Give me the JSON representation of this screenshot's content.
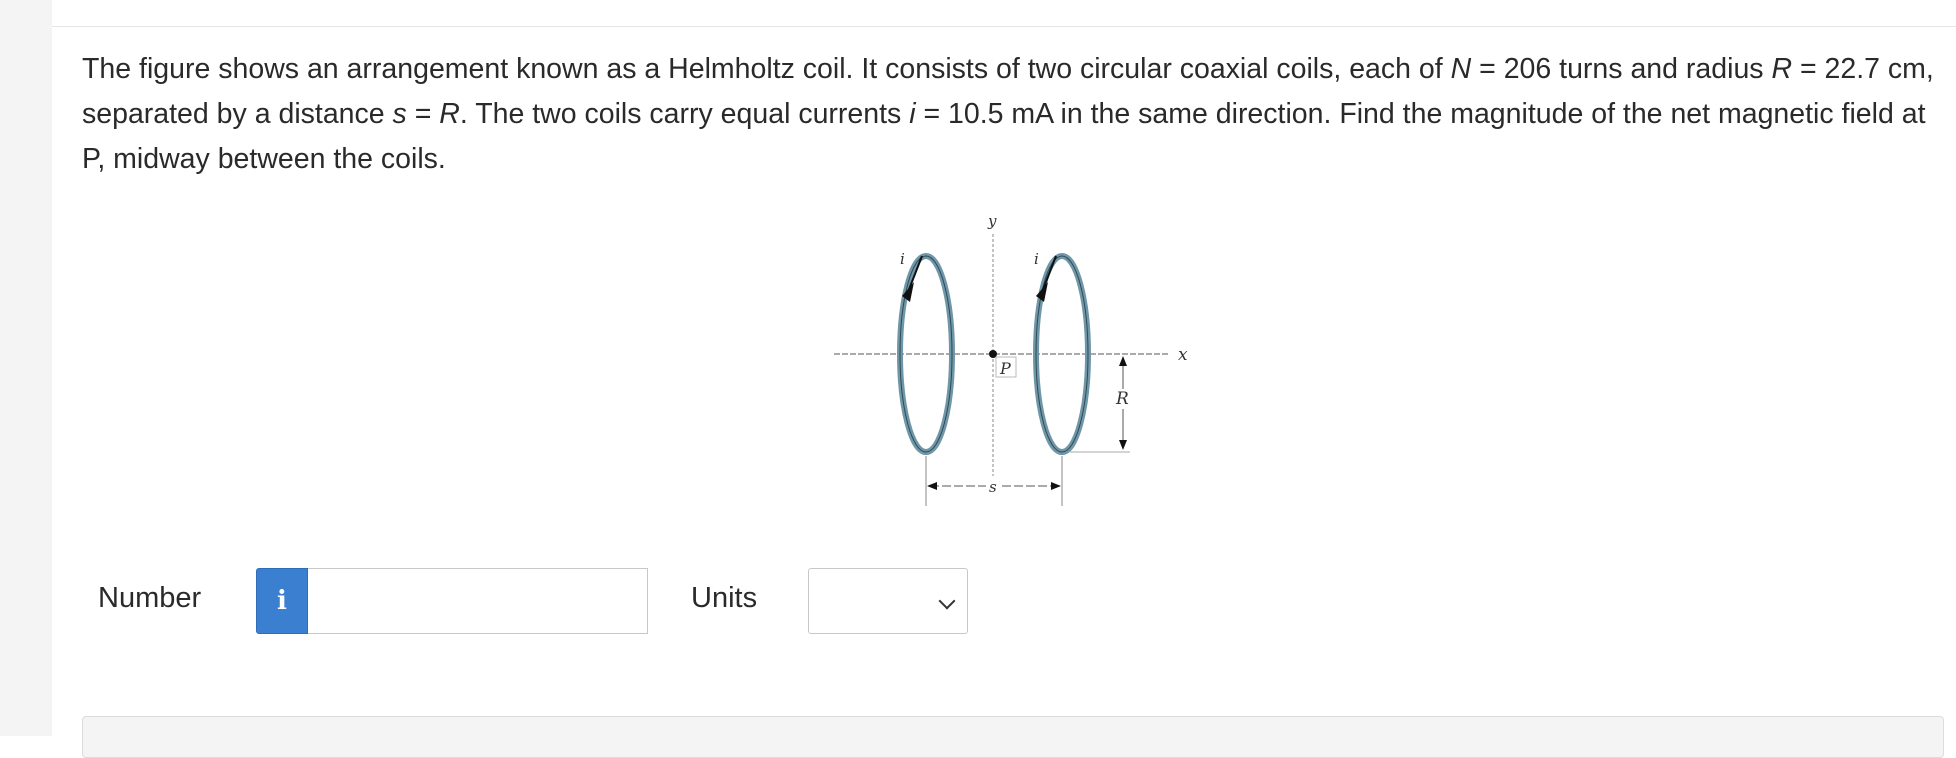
{
  "question": {
    "p1": "The figure shows an arrangement known as a Helmholtz coil. It consists of two circular coaxial coils, each of ",
    "N_sym": "N",
    "p2": " = 206 turns and radius ",
    "R_sym1": "R",
    "p3": " = 22.7 cm, separated by a distance ",
    "s_sym": "s",
    "p4": " = ",
    "R_sym2": "R",
    "p5": ". The two coils carry equal currents ",
    "i_sym": "i",
    "p6": " = 10.5 mA in the same direction. Find the magnitude of the net magnetic field at P, midway between the coils."
  },
  "figure": {
    "label_y": "y",
    "label_x": "x",
    "label_P": "P",
    "label_R": "R",
    "label_s": "s",
    "label_i1": "i",
    "label_i2": "i"
  },
  "answer": {
    "number_label": "Number",
    "info_icon": "i",
    "number_value": "",
    "units_label": "Units",
    "units_selected": ""
  },
  "colors": {
    "coil": "#6f97a8",
    "info_button": "#3b7fd0"
  }
}
